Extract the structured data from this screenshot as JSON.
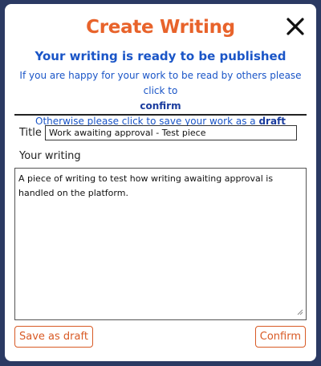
{
  "dialog": {
    "title": "Create Writing",
    "subtitle": "Your writing is ready to be published",
    "info_line1": "If you are happy for your work to be read by others please click to",
    "info_confirm": "confirm",
    "info_line3_prefix": "Otherwise please click to save your work as a ",
    "info_draft": "draft",
    "close_icon": "close-x-icon"
  },
  "form": {
    "title_label": "Title",
    "title_value": "Work awaiting approval - Test piece",
    "writing_label": "Your writing",
    "writing_value": "A piece of writing to test how writing awaiting approval is handled on the platform."
  },
  "buttons": {
    "save_draft": "Save as draft",
    "confirm": "Confirm"
  },
  "colors": {
    "accent_orange": "#e8632b",
    "accent_blue": "#1a55c7",
    "backdrop": "#2b3a63"
  }
}
